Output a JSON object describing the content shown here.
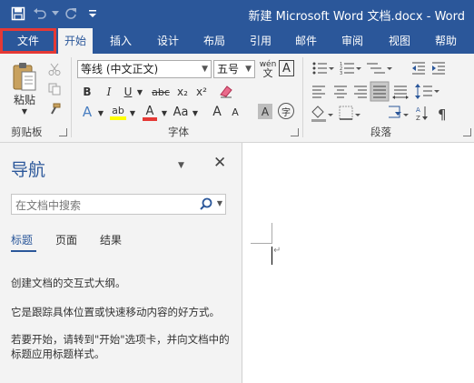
{
  "window": {
    "title": "新建 Microsoft Word 文档.docx - Word",
    "brand_color": "#2b579a",
    "highlight_color": "#e53935"
  },
  "quick_access": {
    "icons": [
      "save-icon",
      "undo-icon",
      "redo-icon",
      "customize-icon"
    ]
  },
  "tabs": [
    {
      "label": "文件"
    },
    {
      "label": "开始",
      "active": true
    },
    {
      "label": "插入"
    },
    {
      "label": "设计"
    },
    {
      "label": "布局"
    },
    {
      "label": "引用"
    },
    {
      "label": "邮件"
    },
    {
      "label": "审阅"
    },
    {
      "label": "视图"
    },
    {
      "label": "帮助"
    }
  ],
  "ribbon": {
    "clipboard": {
      "label": "剪贴板",
      "paste_label": "粘贴"
    },
    "font": {
      "label": "字体",
      "font_name": "等线 (中文正文)",
      "font_size": "五号",
      "wen_glyph": "wén",
      "a_glyph": "A",
      "bold": "B",
      "italic": "I",
      "underline": "U",
      "strike": "abc",
      "subscript": "x₂",
      "superscript": "x²",
      "text_effect": "A",
      "highlight": "ab",
      "font_color": "A",
      "case": "Aa",
      "grow": "A",
      "shrink": "A",
      "char_shading": "A",
      "enclose": "字"
    },
    "paragraph": {
      "label": "段落"
    }
  },
  "nav_pane": {
    "title": "导航",
    "search_placeholder": "在文档中搜索",
    "tabs": [
      "标题",
      "页面",
      "结果"
    ],
    "paragraphs": [
      "创建文档的交互式大纲。",
      "它是跟踪具体位置或快速移动内容的好方式。",
      "若要开始，请转到\"开始\"选项卡，并向文档中的标题应用标题样式。"
    ]
  },
  "document": {
    "paragraph_mark": "↵"
  }
}
